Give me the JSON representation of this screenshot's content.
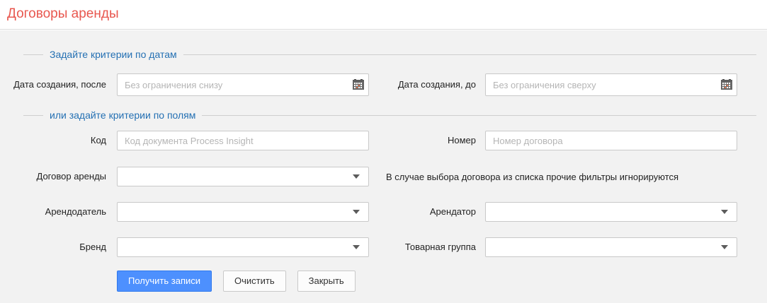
{
  "window": {
    "title": "Договоры аренды"
  },
  "date_section": {
    "legend": "Задайте критерии по датам",
    "date_after": {
      "label": "Дата создания, после",
      "placeholder": "Без ограничения снизу"
    },
    "date_to": {
      "label": "Дата создания, до",
      "placeholder": "Без ограничения сверху"
    }
  },
  "field_section": {
    "legend": "или задайте критерии по полям",
    "code": {
      "label": "Код",
      "placeholder": "Код документа Process Insight"
    },
    "number": {
      "label": "Номер",
      "placeholder": "Номер договора"
    },
    "contract": {
      "label": "Договор аренды",
      "value": ""
    },
    "contract_note": "В случае выбора договора из списка прочие фильтры игнорируются",
    "lessor": {
      "label": "Арендодатель",
      "value": ""
    },
    "tenant": {
      "label": "Арендатор",
      "value": ""
    },
    "brand": {
      "label": "Бренд",
      "value": ""
    },
    "product_group": {
      "label": "Товарная группа",
      "value": ""
    }
  },
  "actions": {
    "submit": "Получить записи",
    "clear": "Очистить",
    "close": "Закрыть"
  },
  "icons": {
    "calendar": "calendar-icon",
    "dropdown_arrow": "chevron-down-icon"
  },
  "colors": {
    "title": "#e8574f",
    "section_legend": "#2470b3",
    "panel_bg": "#f2f2f2",
    "primary_button": "#4d90fe",
    "primary_button_border": "#3079ed",
    "calendar_accent": "#e8764f"
  }
}
